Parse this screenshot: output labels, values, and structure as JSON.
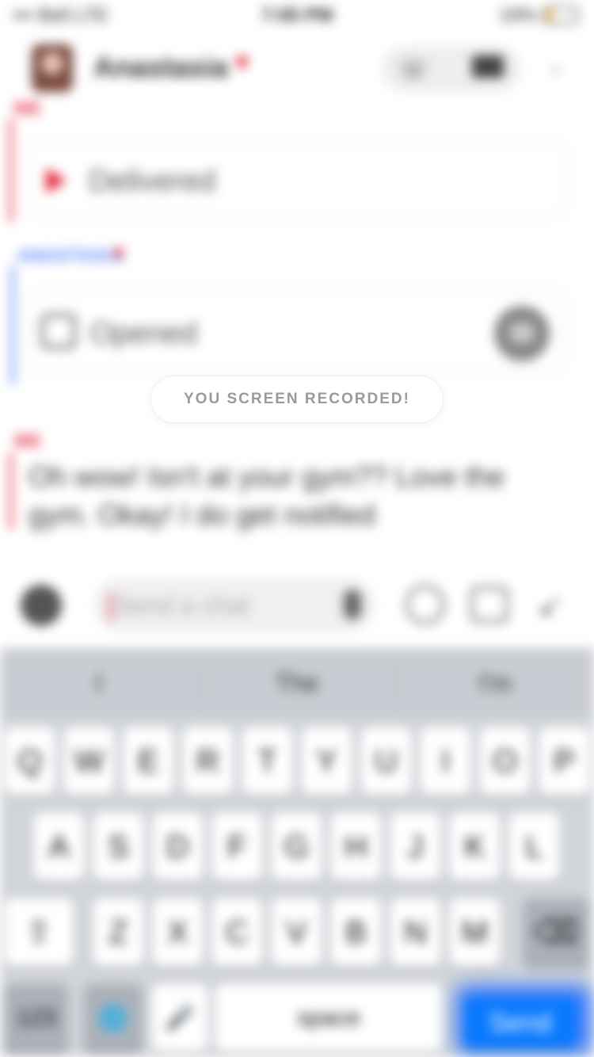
{
  "status_bar": {
    "carrier": "••• Bell LTE",
    "time": "7:05 PM",
    "battery": "19%",
    "battery_level": 0.19,
    "battery_color": "#f5a623"
  },
  "header": {
    "contact_name": "Anastasia",
    "name_emoji": "♥",
    "icons": [
      "phone-icon",
      "video-icon",
      "more-icon"
    ]
  },
  "messages": [
    {
      "sender": "ME",
      "sender_color": "#e5243b",
      "status": "Delivered",
      "status_icon": "red-arrow-icon"
    },
    {
      "sender": "ANASTASIA",
      "sender_color": "#4f7cf7",
      "status": "Opened",
      "status_icon": "opened-square-icon",
      "action_icon": "replay-icon"
    },
    {
      "sender": "ME",
      "sender_color": "#e5243b",
      "text": "Oh wow! Isn't at your gym?? Love the gym. Okay! I do get notified"
    }
  ],
  "notice": "YOU SCREEN RECORDED!",
  "input_bar": {
    "placeholder": "Send a chat",
    "icons": [
      "camera-icon",
      "mic-icon",
      "emoji-icon",
      "sticker-icon",
      "rocket-icon"
    ]
  },
  "keyboard": {
    "predictions": [
      "I",
      "The",
      "I'm"
    ],
    "row1": [
      "Q",
      "W",
      "E",
      "R",
      "T",
      "Y",
      "U",
      "I",
      "O",
      "P"
    ],
    "row2": [
      "A",
      "S",
      "D",
      "F",
      "G",
      "H",
      "J",
      "K",
      "L"
    ],
    "row3": [
      "Z",
      "X",
      "C",
      "V",
      "B",
      "N",
      "M"
    ],
    "shift_label": "⇧",
    "backspace_label": "⌫",
    "numbers_label": "123",
    "globe_label": "🌐",
    "mic_label": "🎤",
    "space_label": "space",
    "go_label": "Send",
    "go_color": "#0a79ff"
  }
}
